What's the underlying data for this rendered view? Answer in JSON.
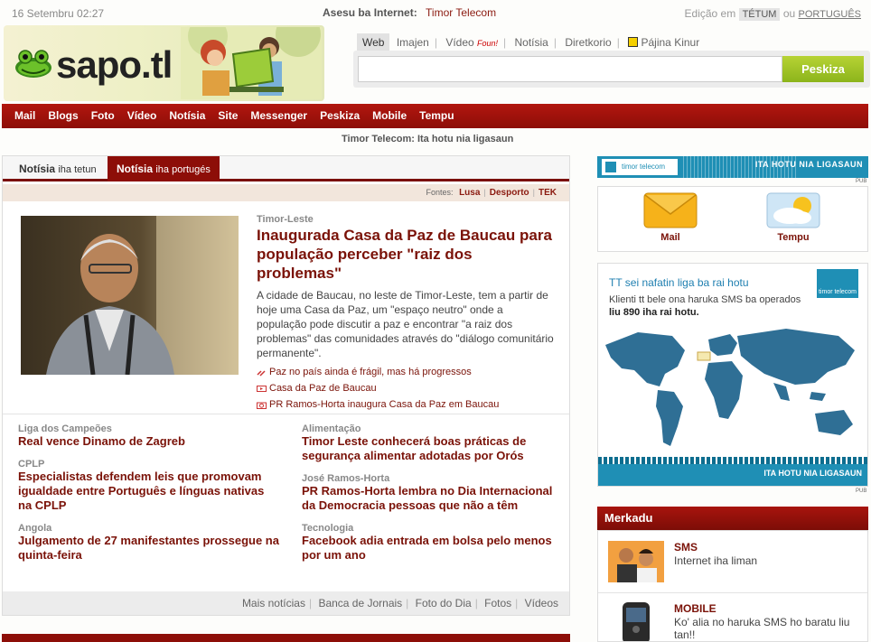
{
  "header": {
    "date": "16 Setembru 02:27",
    "access_label": "Asesu ba Internet:",
    "access_provider": "Timor Telecom",
    "edition_label": "Edição em",
    "edition_current": "TÉTUM",
    "edition_or": "ou",
    "edition_alt": "PORTUGUÊS"
  },
  "logo": {
    "text": "sapo.tl"
  },
  "search": {
    "tabs": [
      "Web",
      "Imajen",
      "Vídeo",
      "Notísia",
      "Diretkorio",
      "Pájina Kinur"
    ],
    "video_badge": "Foun!",
    "button": "Peskiza",
    "value": ""
  },
  "nav": [
    "Mail",
    "Blogs",
    "Foto",
    "Vídeo",
    "Notísia",
    "Site",
    "Messenger",
    "Peskiza",
    "Mobile",
    "Tempu"
  ],
  "ticker": "Timor Telecom: Ita hotu nia ligasaun",
  "news": {
    "tab1_main": "Notísia",
    "tab1_sub": "iha tetun",
    "tab2_main": "Notísia",
    "tab2_sub": "iha portugés",
    "sources_label": "Fontes:",
    "sources": [
      "Lusa",
      "Desporto",
      "TEK"
    ],
    "main": {
      "kicker": "Timor-Leste",
      "headline": "Inaugurada Casa da Paz de Baucau para população perceber \"raiz dos problemas\"",
      "lede": "A cidade de Baucau, no leste de Timor-Leste, tem a partir de hoje uma Casa da Paz, um \"espaço neutro\" onde a população pode discutir a paz e encontrar \"a raiz dos problemas\" das comunidades através do \"diálogo comunitário permanente\".",
      "related": [
        "Paz no país ainda é frágil, mas há progressos",
        "Casa da Paz de Baucau",
        "PR Ramos-Horta inaugura Casa da Paz em Baucau"
      ]
    },
    "left": [
      {
        "kicker": "Liga dos Campeões",
        "headline": "Real vence Dinamo de Zagreb"
      },
      {
        "kicker": "CPLP",
        "headline": "Especialistas defendem leis que promovam igualdade entre Português e línguas nativas na CPLP"
      },
      {
        "kicker": "Angola",
        "headline": "Julgamento de 27 manifestantes prossegue na quinta-feira"
      }
    ],
    "right": [
      {
        "kicker": "Alimentação",
        "headline": "Timor Leste conhecerá boas práticas de segurança alimentar adotadas por Orós"
      },
      {
        "kicker": "José Ramos-Horta",
        "headline": "PR Ramos-Horta lembra no Dia Internacional da Democracia pessoas que não a têm"
      },
      {
        "kicker": "Tecnologia",
        "headline": "Facebook adia entrada em bolsa pelo menos por um ano"
      }
    ],
    "footer_links": [
      "Mais notícias",
      "Banca de Jornais",
      "Foto do Dia",
      "Fotos",
      "Vídeos"
    ]
  },
  "ads": {
    "banner_text": "ITA HOTU NIA LIGASAUN",
    "banner_logo": "timor telecom",
    "pub": "PUB",
    "box_title": "TT sei nafatin liga ba rai hotu",
    "box_line1": "Klienti tt bele ona haruka SMS ba operados",
    "box_line2": "liu 890 iha rai hotu.",
    "box_logo": "timor telecom"
  },
  "services": [
    "Mail",
    "Tempu"
  ],
  "market": {
    "title": "Merkadu",
    "items": [
      {
        "title": "SMS",
        "desc": "Internet iha liman"
      },
      {
        "title": "MOBILE",
        "desc": "Ko' alia no haruka SMS ho baratu liu tan!!"
      }
    ]
  }
}
